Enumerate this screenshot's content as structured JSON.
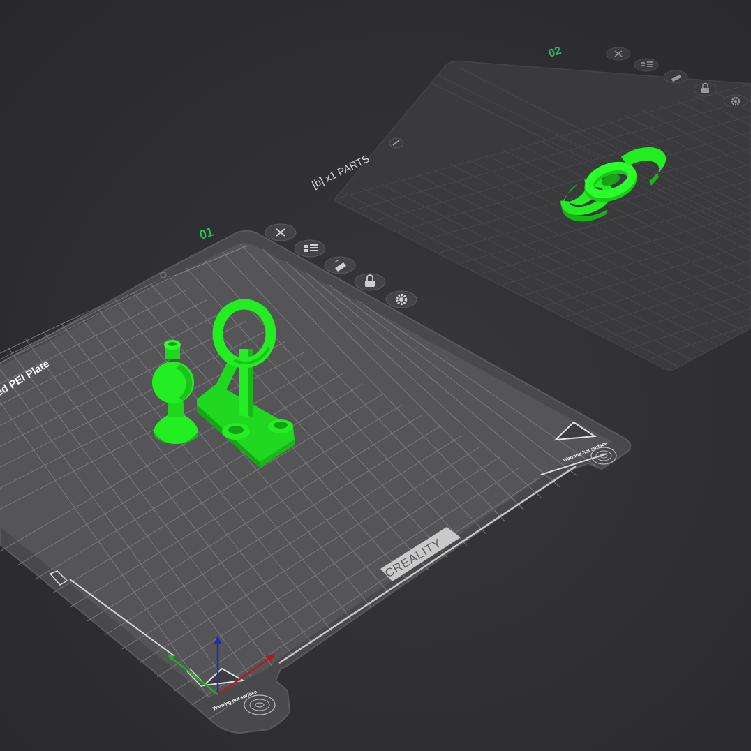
{
  "plates": [
    {
      "index_label": "01",
      "bed_title": "ed PEI Plate",
      "brand": "CREALITY",
      "warning_text": "Warning hot surface",
      "tools": [
        "close-icon",
        "arrange-icon",
        "auto-orient-icon",
        "lock-icon",
        "settings-icon"
      ]
    },
    {
      "index_label": "02",
      "parts_label": "[b] x1 PARTS",
      "tools": [
        "close-icon",
        "arrange-icon",
        "auto-orient-icon",
        "lock-icon",
        "settings-icon"
      ]
    }
  ],
  "colors": {
    "background": "#2d2d30",
    "bed_surface": "#4a4a4d",
    "grid_line": "#6e6e72",
    "model_green": "#22ee22",
    "label_green": "#27c45c",
    "axis_x": "#b01c1c",
    "axis_y": "#1cb01c",
    "axis_z": "#1c2fb0"
  }
}
